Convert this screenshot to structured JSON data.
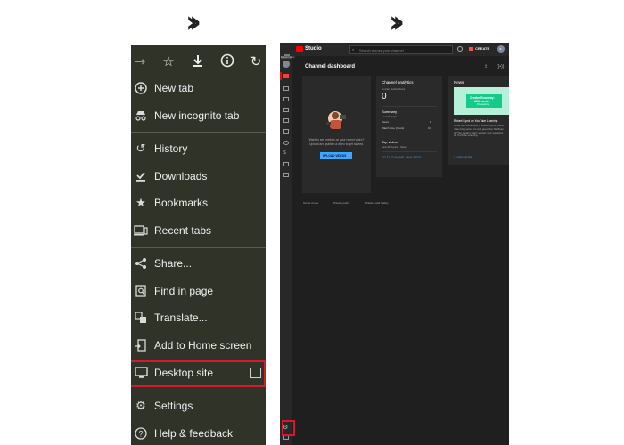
{
  "phone_menu": {
    "items": [
      {
        "label": "New tab",
        "icon": "plus-box-icon"
      },
      {
        "label": "New incognito tab",
        "icon": "incognito-icon"
      },
      {
        "label": "History",
        "icon": "history-icon"
      },
      {
        "label": "Downloads",
        "icon": "download-check-icon"
      },
      {
        "label": "Bookmarks",
        "icon": "star-icon"
      },
      {
        "label": "Recent tabs",
        "icon": "devices-icon"
      },
      {
        "label": "Share...",
        "icon": "share-icon"
      },
      {
        "label": "Find in page",
        "icon": "find-in-page-icon"
      },
      {
        "label": "Translate...",
        "icon": "translate-icon"
      },
      {
        "label": "Add to Home screen",
        "icon": "add-to-home-icon"
      },
      {
        "label": "Desktop site",
        "icon": "monitor-icon"
      },
      {
        "label": "Settings",
        "icon": "gear-icon"
      },
      {
        "label": "Help & feedback",
        "icon": "help-icon"
      }
    ],
    "desktop_site_checked": false
  },
  "studio": {
    "logo": "Studio",
    "search_placeholder": "Search across your channel",
    "create_label": "CREATE",
    "avatar_letter": "s",
    "page_title": "Channel dashboard",
    "upload_card": {
      "text": "Want to see metrics on your recent video? Upload and publish a video to get started.",
      "button": "UPLOAD VIDEOS"
    },
    "analytics": {
      "title": "Channel analytics",
      "subs_label": "Current subscribers",
      "subs_value": "0",
      "summary_label": "Summary",
      "summary_period": "Last 28 days",
      "views_label": "Views",
      "views_value": "0",
      "watch_label": "Watch time (hours)",
      "watch_value": "0.0",
      "top_videos_label": "Top videos",
      "top_videos_period": "Last 48 hours · Views",
      "link": "GO TO CHANNEL ANALYTICS"
    },
    "news": {
      "title": "News",
      "banner_line1": "Creator Economy:",
      "banner_line2": "AMA series",
      "banner_line3": "#1 Learning",
      "headline": "Robert Kyncl on YouTube Learning",
      "body": "In the next installment of Robert Kyncl's AMA video blog series, he and guest Jon Stoffman of \"The Coding Train\" answer your questions on YouTube Learning.",
      "link": "LEARN MORE"
    },
    "footer": [
      "Terms of use",
      "Privacy policy",
      "Policies and Safety"
    ],
    "expand_tooltip": "Expand menu"
  },
  "colors": {
    "highlight": "#d41b2c",
    "phone_bg": "#303328",
    "studio_bg": "#1f1f1f",
    "upload_blue": "#3ea6ff"
  }
}
